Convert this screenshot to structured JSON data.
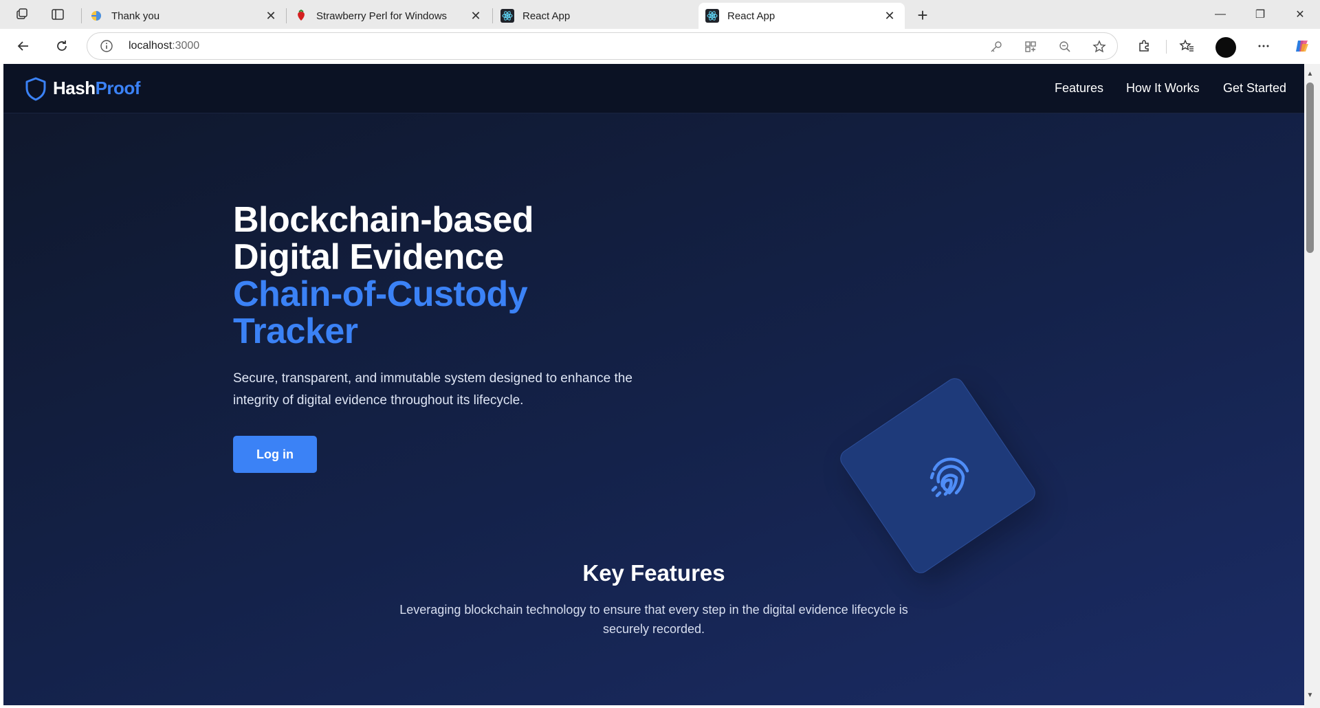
{
  "browser": {
    "tabs": [
      {
        "title": "Thank you",
        "active": false,
        "favicon": "globe-icon"
      },
      {
        "title": "Strawberry Perl for Windows",
        "active": false,
        "favicon": "strawberry-icon"
      },
      {
        "title": "React App",
        "active": false,
        "favicon": "react-icon"
      },
      {
        "title": "React App",
        "active": true,
        "favicon": "react-icon"
      }
    ],
    "new_tab_label": "+",
    "address": {
      "host": "localhost",
      "port": ":3000"
    },
    "window_controls": {
      "minimize": "—",
      "restore": "❐",
      "close": "✕"
    },
    "tab_close_glyph": "✕"
  },
  "site": {
    "logo": {
      "part1": "Hash",
      "part2": "Proof"
    },
    "nav": [
      "Features",
      "How It Works",
      "Get Started"
    ]
  },
  "hero": {
    "title_line1": "Blockchain-based",
    "title_line2": "Digital Evidence",
    "title_accent1": "Chain-of-Custody",
    "title_accent2": "Tracker",
    "description": "Secure, transparent, and immutable system designed to enhance the integrity of digital evidence throughout its lifecycle.",
    "cta": "Log in"
  },
  "features": {
    "title": "Key Features",
    "description": "Leveraging blockchain technology to ensure that every step in the digital evidence lifecycle is securely recorded."
  },
  "colors": {
    "accent": "#3b82f6",
    "nav_bg": "#0b1224",
    "page_bg": "#14224a"
  }
}
